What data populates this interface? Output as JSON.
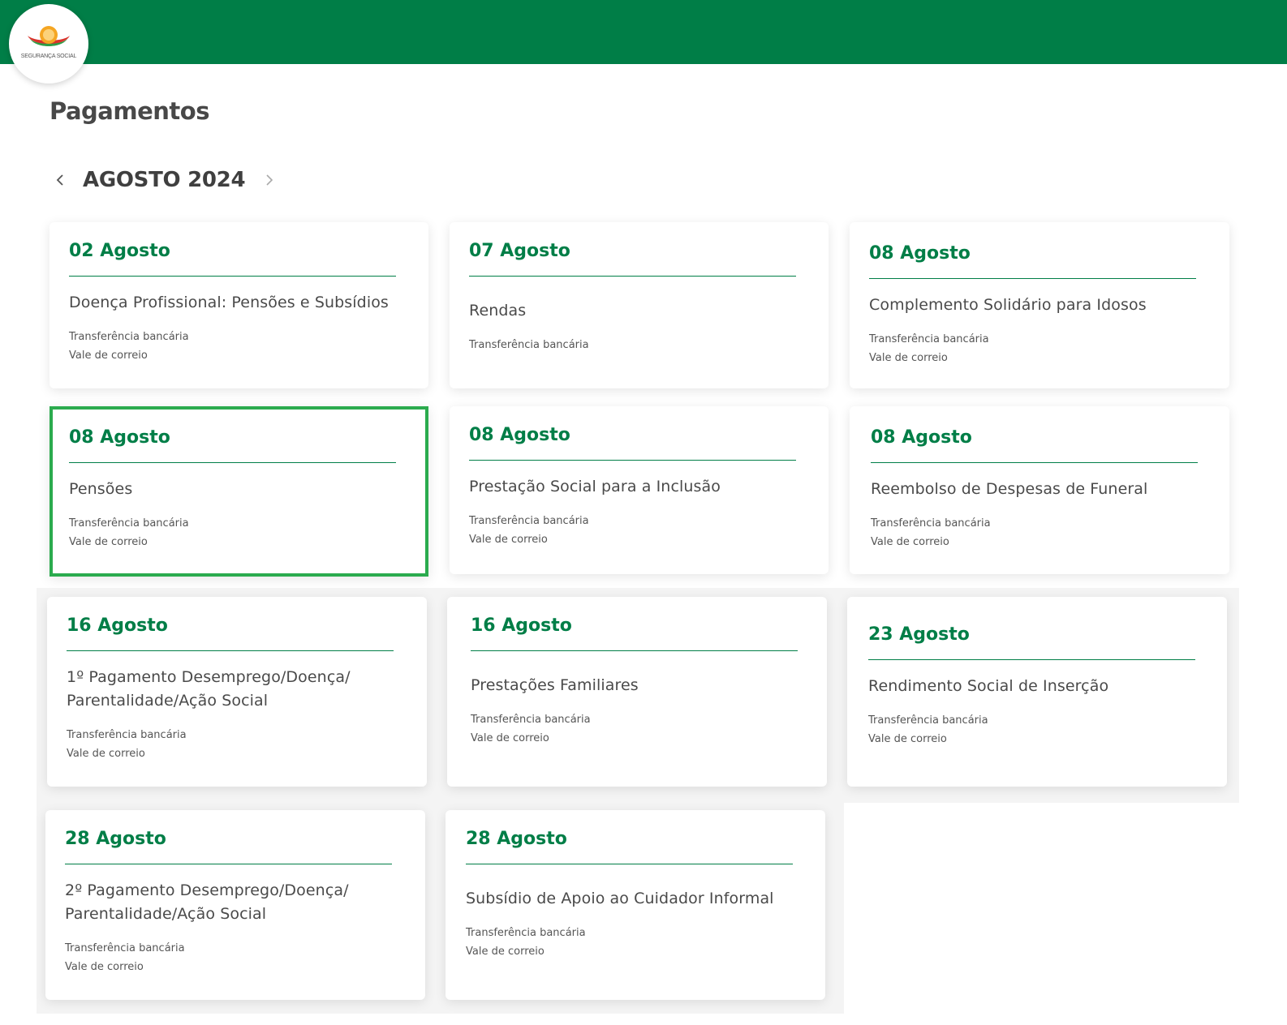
{
  "header": {
    "brand_color": "#007e47",
    "logo": {
      "icon": "seguranca-social-logo-icon",
      "text": "SEGURANÇA SOCIAL"
    }
  },
  "page": {
    "title": "Pagamentos"
  },
  "calendar": {
    "month_label": "AGOSTO 2024",
    "prev_icon": "chevron-left-icon",
    "next_icon": "chevron-right-icon"
  },
  "colors": {
    "accent": "#007e47",
    "selected_border": "#2bab4e"
  },
  "cards": [
    {
      "date": "02 Agosto",
      "title": "Doença Profissional: Pensões e Subsídios",
      "methods": [
        "Transferência bancária",
        "Vale de correio"
      ]
    },
    {
      "date": "07 Agosto",
      "title": "Rendas",
      "methods": [
        "Transferência bancária"
      ]
    },
    {
      "date": "08 Agosto",
      "title": "Complemento Solidário para Idosos",
      "methods": [
        "Transferência bancária",
        "Vale de correio"
      ]
    },
    {
      "date": "08 Agosto",
      "title": "Pensões",
      "methods": [
        "Transferência bancária",
        "Vale de correio"
      ],
      "selected": true
    },
    {
      "date": "08 Agosto",
      "title": "Prestação Social para a Inclusão",
      "methods": [
        "Transferência bancária",
        "Vale de correio"
      ]
    },
    {
      "date": "08 Agosto",
      "title": "Reembolso de Despesas de Funeral",
      "methods": [
        "Transferência bancária",
        "Vale de correio"
      ]
    },
    {
      "date": "16 Agosto",
      "title": "1º Pagamento Desemprego/Doença/ Parentalidade/Ação Social",
      "methods": [
        "Transferência bancária",
        "Vale de correio"
      ]
    },
    {
      "date": "16 Agosto",
      "title": "Prestações Familiares",
      "methods": [
        "Transferência bancária",
        "Vale de correio"
      ]
    },
    {
      "date": "23 Agosto",
      "title": "Rendimento Social de Inserção",
      "methods": [
        "Transferência bancária",
        "Vale de correio"
      ]
    },
    {
      "date": "28 Agosto",
      "title": "2º Pagamento Desemprego/Doença/ Parentalidade/Ação Social",
      "methods": [
        "Transferência bancária",
        "Vale de correio"
      ]
    },
    {
      "date": "28 Agosto",
      "title": "Subsídio de Apoio ao Cuidador Informal",
      "methods": [
        "Transferência bancária",
        "Vale de correio"
      ]
    }
  ]
}
